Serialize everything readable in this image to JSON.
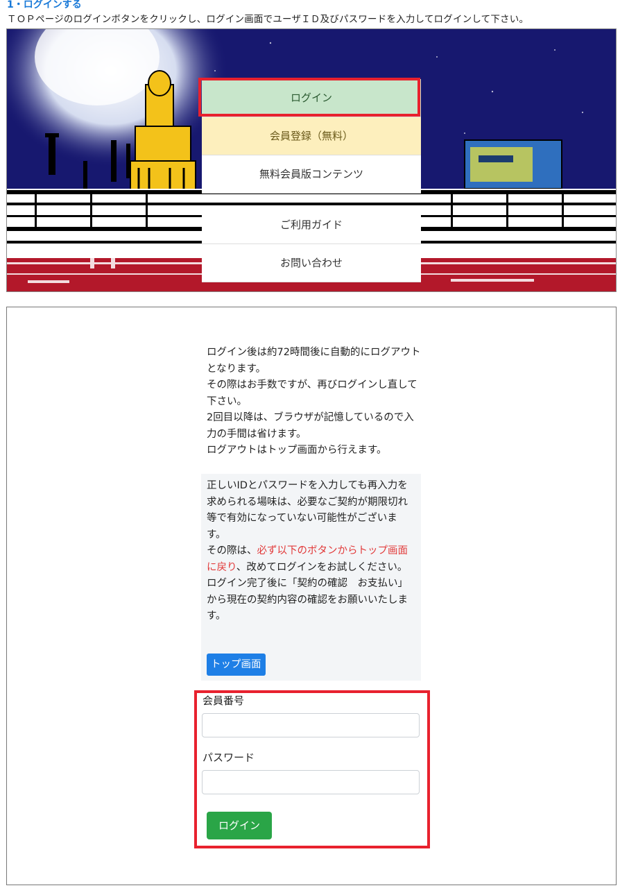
{
  "step": {
    "title": "1・ログインする",
    "instruction": "ＴＯＰページのログインボタンをクリックし、ログイン画面でユーザＩＤ及びパスワードを入力してログインして下さい。"
  },
  "hero": {
    "menu": [
      {
        "label": "ログイン"
      },
      {
        "label": "会員登録（無料）"
      },
      {
        "label": "無料会員版コンテンツ"
      },
      {
        "label": "ご利用ガイド"
      },
      {
        "label": "お問い合わせ"
      }
    ]
  },
  "login_page": {
    "notice_lines": [
      "ログイン後は約72時間後に自動的にログアウトとなります。",
      "その際はお手数ですが、再びログインし直して下さい。",
      "2回目以降は、ブラウザが記憶しているので入力の手間は省けます。",
      "ログアウトはトップ画面から行えます。"
    ],
    "warning": {
      "line1": "正しいIDとパスワードを入力しても再入力を求められる場味は、必要なご契約が期限切れ等で有効になっていない可能性がございます。",
      "line2_prefix": "その際は、",
      "line2_red": "必ず以下のボタンからトップ画面に戻り",
      "line2_suffix": "、改めてログインをお試しください。",
      "line3": "ログイン完了後に「契約の確認　お支払い」から現在の契約内容の確認をお願いいたします。"
    },
    "top_button": "トップ画面",
    "member_number_label": "会員番号",
    "member_number_value": "",
    "password_label": "パスワード",
    "password_value": "",
    "login_button": "ログイン"
  },
  "colors": {
    "accent_title": "#1a7ad8",
    "highlight": "#e8212e",
    "login_menu_bg": "#c8e6cb",
    "register_menu_bg": "#fdefbd",
    "top_button": "#1e7fe6",
    "login_button": "#2aa547",
    "warning_red": "#e23a3a"
  }
}
